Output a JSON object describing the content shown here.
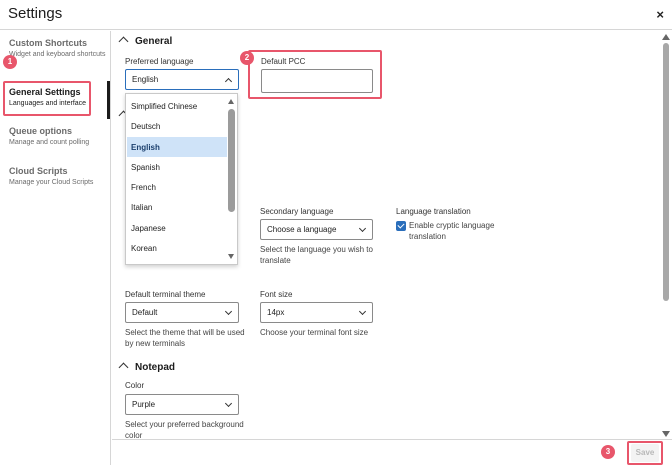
{
  "header": {
    "title": "Settings",
    "close_glyph": "×"
  },
  "sidebar": {
    "items": [
      {
        "label": "Custom Shortcuts",
        "sub": "Widget and keyboard shortcuts"
      },
      {
        "label": "General Settings",
        "sub": "Languages and interface"
      },
      {
        "label": "Queue options",
        "sub": "Manage and count polling"
      },
      {
        "label": "Cloud Scripts",
        "sub": "Manage your Cloud Scripts"
      }
    ]
  },
  "main": {
    "general": {
      "title": "General",
      "preferred_language": {
        "label": "Preferred language",
        "value": "English"
      },
      "default_pcc": {
        "label": "Default PCC",
        "value": ""
      },
      "dropdown_options": [
        "Simplified Chinese",
        "Deutsch",
        "English",
        "Spanish",
        "French",
        "Italian",
        "Japanese",
        "Korean"
      ],
      "selected_option": "English",
      "secondary_language": {
        "label": "Secondary language",
        "value": "Choose a language",
        "help": "Select the language you wish to translate"
      },
      "language_translation": {
        "label": "Language translation",
        "checkbox_label": "Enable cryptic language translation",
        "checked": true
      },
      "terminal_theme": {
        "label": "Default terminal theme",
        "value": "Default",
        "help": "Select the theme that will be used by new terminals"
      },
      "font_size": {
        "label": "Font size",
        "value": "14px",
        "help": "Choose your terminal font size"
      }
    },
    "notepad": {
      "title": "Notepad",
      "color": {
        "label": "Color",
        "value": "Purple",
        "help": "Select your preferred background color"
      }
    }
  },
  "footer": {
    "save_label": "Save"
  },
  "annotations": {
    "badge1": "1",
    "badge2": "2",
    "badge3": "3"
  },
  "colors": {
    "highlight": "#e8566b",
    "accent": "#2a6ebb",
    "selected_option_bg": "#cfe3f8"
  }
}
